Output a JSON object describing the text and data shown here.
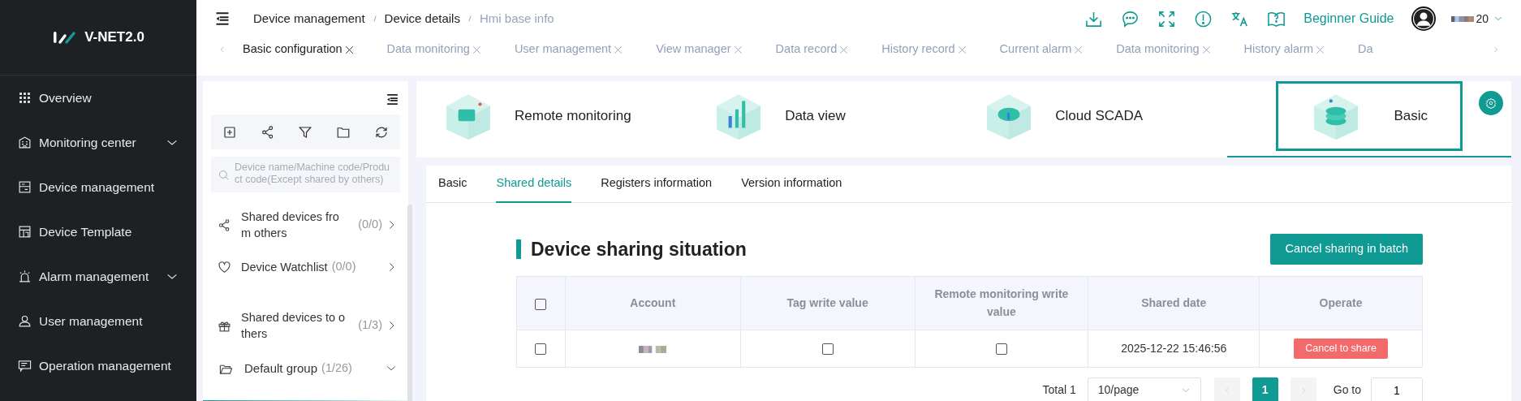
{
  "sidebar": {
    "logo": "V-NET2.0",
    "items": [
      {
        "label": "Overview",
        "kind": "link"
      },
      {
        "label": "Monitoring center",
        "kind": "group"
      },
      {
        "label": "Device management",
        "kind": "link"
      },
      {
        "label": "Device Template",
        "kind": "link"
      },
      {
        "label": "Alarm management",
        "kind": "group"
      },
      {
        "label": "User management",
        "kind": "link"
      },
      {
        "label": "Operation management",
        "kind": "link"
      }
    ]
  },
  "header": {
    "breadcrumb": [
      "Device management",
      "Device details",
      "Hmi base info"
    ],
    "guide": "Beginner Guide",
    "user": "20"
  },
  "tabs": [
    {
      "label": "Basic configuration",
      "selected": true
    },
    {
      "label": "Data monitoring",
      "selected": false
    },
    {
      "label": "User management",
      "selected": false
    },
    {
      "label": "View manager",
      "selected": false
    },
    {
      "label": "Data record",
      "selected": false
    },
    {
      "label": "History record",
      "selected": false
    },
    {
      "label": "Current alarm",
      "selected": false
    },
    {
      "label": "Data monitoring",
      "selected": false
    },
    {
      "label": "History alarm",
      "selected": false
    },
    {
      "label": "Da",
      "selected": false
    }
  ],
  "device_panel": {
    "search": {
      "placeholder": "Device name/Machine code/Product code(Except shared by others)"
    },
    "groups": [
      {
        "label": "Shared devices from others",
        "count": "(0/0)",
        "kind": "share"
      },
      {
        "label": "Device Watchlist",
        "count": "(0/0)",
        "kind": "watch"
      },
      {
        "label": "Shared devices to others",
        "count": "(1/3)",
        "kind": "gift"
      },
      {
        "label": "Default group",
        "count": "(1/26)",
        "kind": "folder"
      }
    ]
  },
  "cards": [
    {
      "label": "Remote monitoring",
      "selected": false
    },
    {
      "label": "Data view",
      "selected": false
    },
    {
      "label": "Cloud SCADA",
      "selected": false
    },
    {
      "label": "Basic",
      "selected": true
    }
  ],
  "detail_tabs": [
    {
      "label": "Basic",
      "selected": false
    },
    {
      "label": "Shared details",
      "selected": true
    },
    {
      "label": "Registers information",
      "selected": false
    },
    {
      "label": "Version information",
      "selected": false
    }
  ],
  "section": {
    "title": "Device sharing situation",
    "batch_button": "Cancel sharing in batch"
  },
  "table": {
    "select_all": {
      "checked": false
    },
    "columns": [
      "Account",
      "Tag write value",
      "Remote monitoring write value",
      "Shared date",
      "Operate"
    ],
    "rows": [
      {
        "checked": false,
        "tag_write": false,
        "remote_write": false,
        "shared_date": "2025-12-22 15:46:56",
        "action": "Cancel to share"
      }
    ]
  },
  "pagination": {
    "total": "Total 1",
    "page_size": "10/page",
    "pages": [
      {
        "label": "1",
        "selected": true
      }
    ],
    "goto_label": "Go to",
    "goto_value": "1"
  }
}
